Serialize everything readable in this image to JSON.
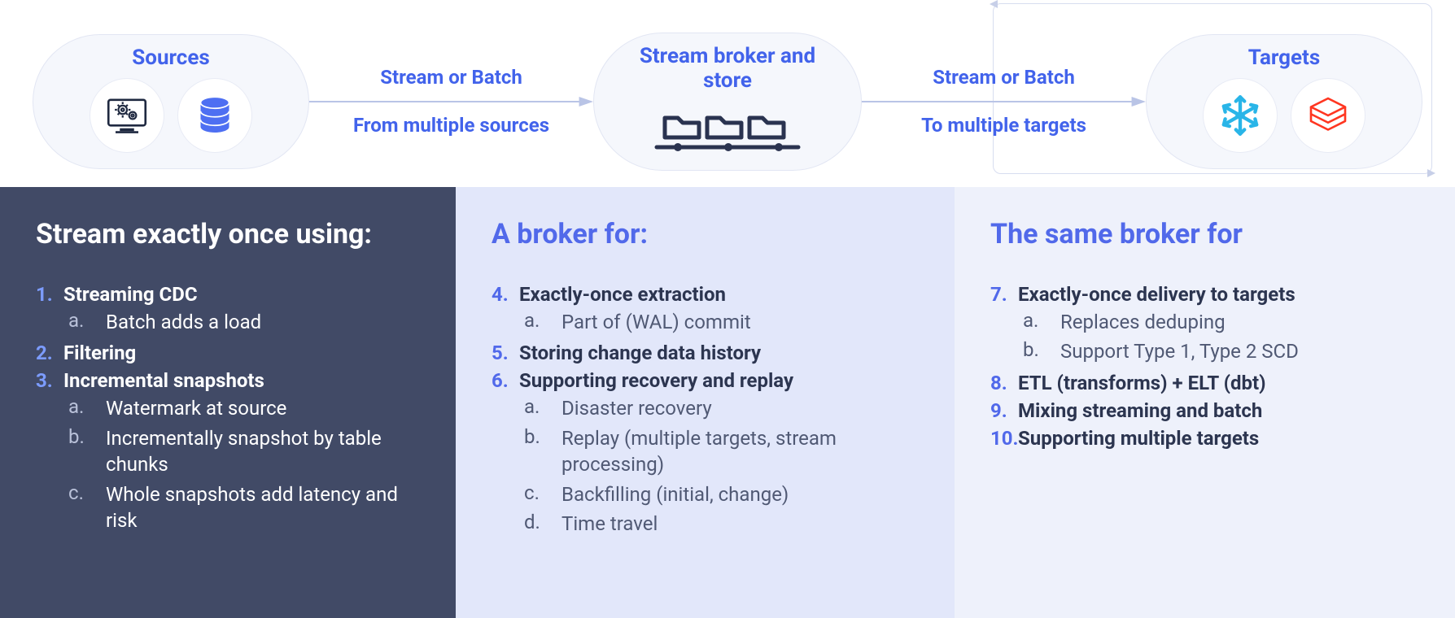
{
  "flow": {
    "sources": {
      "title": "Sources"
    },
    "arrow1": {
      "top": "Stream or Batch",
      "bottom": "From multiple sources"
    },
    "broker": {
      "title": "Stream broker and store"
    },
    "arrow2": {
      "top": "Stream or Batch",
      "bottom": "To multiple targets"
    },
    "targets": {
      "title": "Targets"
    }
  },
  "columns": {
    "c1": {
      "heading": "Stream exactly once using:",
      "items": [
        {
          "n": "1.",
          "t": "Streaming CDC",
          "subs": [
            {
              "l": "a.",
              "t": "Batch adds a load"
            }
          ]
        },
        {
          "n": "2.",
          "t": "Filtering",
          "subs": []
        },
        {
          "n": "3.",
          "t": "Incremental snapshots",
          "subs": [
            {
              "l": "a.",
              "t": "Watermark at source"
            },
            {
              "l": "b.",
              "t": "Incrementally snapshot by table chunks"
            },
            {
              "l": "c.",
              "t": "Whole snapshots add latency and risk"
            }
          ]
        }
      ]
    },
    "c2": {
      "heading": "A broker for:",
      "items": [
        {
          "n": "4.",
          "t": "Exactly-once extraction",
          "subs": [
            {
              "l": "a.",
              "t": "Part of (WAL) commit"
            }
          ]
        },
        {
          "n": "5.",
          "t": "Storing change data history",
          "subs": []
        },
        {
          "n": "6.",
          "t": "Supporting recovery and replay",
          "subs": [
            {
              "l": "a.",
              "t": "Disaster recovery"
            },
            {
              "l": "b.",
              "t": "Replay (multiple targets, stream processing)"
            },
            {
              "l": "c.",
              "t": "Backfilling (initial, change)"
            },
            {
              "l": "d.",
              "t": "Time travel"
            }
          ]
        }
      ]
    },
    "c3": {
      "heading": "The same broker for",
      "items": [
        {
          "n": "7.",
          "t": "Exactly-once delivery to targets",
          "subs": [
            {
              "l": "a.",
              "t": "Replaces deduping"
            },
            {
              "l": "b.",
              "t": "Support Type 1, Type 2 SCD"
            }
          ]
        },
        {
          "n": "8.",
          "t": "ETL (transforms) + ELT (dbt)",
          "subs": []
        },
        {
          "n": "9.",
          "t": "Mixing streaming and batch",
          "subs": []
        },
        {
          "n": "10.",
          "t": "Supporting multiple targets",
          "subs": []
        }
      ]
    }
  }
}
